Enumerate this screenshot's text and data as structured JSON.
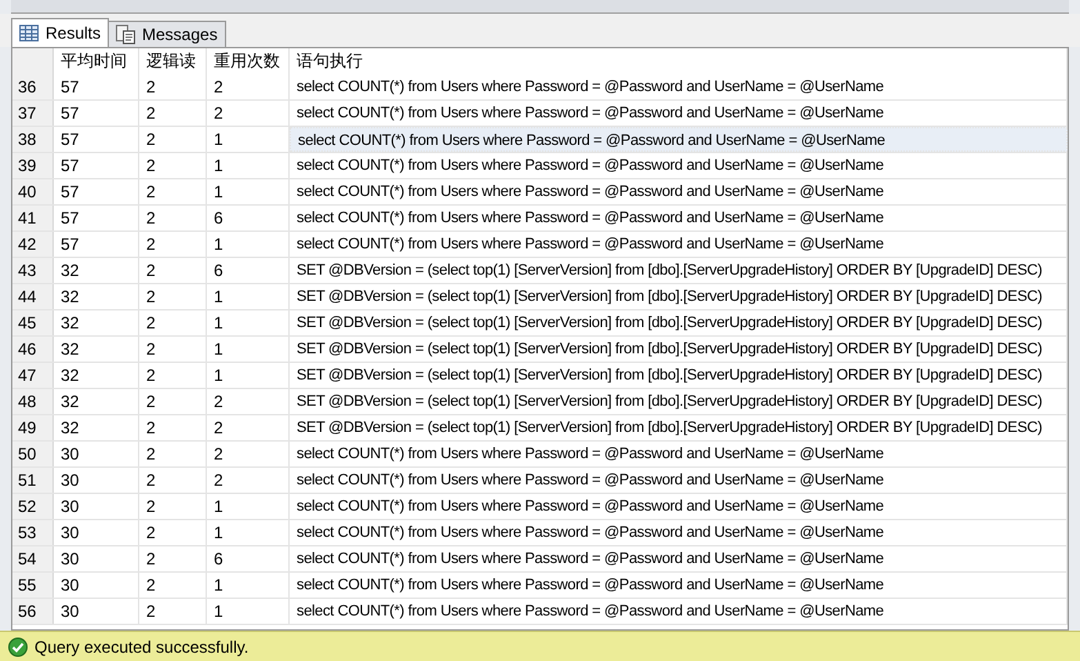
{
  "tabs": [
    {
      "label": "Results",
      "selected": true
    },
    {
      "label": "Messages",
      "selected": false
    }
  ],
  "table": {
    "columns": [
      "平均时间",
      "逻辑读",
      "重用次数",
      "语句执行"
    ],
    "rows": [
      {
        "row_number": "36",
        "cells": [
          "57",
          "2",
          "2",
          "select COUNT(*) from Users where Password = @Password and UserName = @UserName"
        ],
        "selected": false
      },
      {
        "row_number": "37",
        "cells": [
          "57",
          "2",
          "2",
          "select COUNT(*) from Users where Password = @Password and UserName = @UserName"
        ],
        "selected": false
      },
      {
        "row_number": "38",
        "cells": [
          "57",
          "2",
          "1",
          "select COUNT(*) from Users where Password = @Password and UserName = @UserName"
        ],
        "selected": true
      },
      {
        "row_number": "39",
        "cells": [
          "57",
          "2",
          "1",
          "select COUNT(*) from Users where Password = @Password and UserName = @UserName"
        ],
        "selected": false
      },
      {
        "row_number": "40",
        "cells": [
          "57",
          "2",
          "1",
          "select COUNT(*) from Users where Password = @Password and UserName = @UserName"
        ],
        "selected": false
      },
      {
        "row_number": "41",
        "cells": [
          "57",
          "2",
          "6",
          "select COUNT(*) from Users where Password = @Password and UserName = @UserName"
        ],
        "selected": false
      },
      {
        "row_number": "42",
        "cells": [
          "57",
          "2",
          "1",
          "select COUNT(*) from Users where Password = @Password and UserName = @UserName"
        ],
        "selected": false
      },
      {
        "row_number": "43",
        "cells": [
          "32",
          "2",
          "6",
          "SET @DBVersion = (select top(1) [ServerVersion] from [dbo].[ServerUpgradeHistory] ORDER BY [UpgradeID] DESC)"
        ],
        "selected": false
      },
      {
        "row_number": "44",
        "cells": [
          "32",
          "2",
          "1",
          "SET @DBVersion = (select top(1) [ServerVersion] from [dbo].[ServerUpgradeHistory] ORDER BY [UpgradeID] DESC)"
        ],
        "selected": false
      },
      {
        "row_number": "45",
        "cells": [
          "32",
          "2",
          "1",
          "SET @DBVersion = (select top(1) [ServerVersion] from [dbo].[ServerUpgradeHistory] ORDER BY [UpgradeID] DESC)"
        ],
        "selected": false
      },
      {
        "row_number": "46",
        "cells": [
          "32",
          "2",
          "1",
          "SET @DBVersion = (select top(1) [ServerVersion] from [dbo].[ServerUpgradeHistory] ORDER BY [UpgradeID] DESC)"
        ],
        "selected": false
      },
      {
        "row_number": "47",
        "cells": [
          "32",
          "2",
          "1",
          "SET @DBVersion = (select top(1) [ServerVersion] from [dbo].[ServerUpgradeHistory] ORDER BY [UpgradeID] DESC)"
        ],
        "selected": false
      },
      {
        "row_number": "48",
        "cells": [
          "32",
          "2",
          "2",
          "SET @DBVersion = (select top(1) [ServerVersion] from [dbo].[ServerUpgradeHistory] ORDER BY [UpgradeID] DESC)"
        ],
        "selected": false
      },
      {
        "row_number": "49",
        "cells": [
          "32",
          "2",
          "2",
          "SET @DBVersion = (select top(1) [ServerVersion] from [dbo].[ServerUpgradeHistory] ORDER BY [UpgradeID] DESC)"
        ],
        "selected": false
      },
      {
        "row_number": "50",
        "cells": [
          "30",
          "2",
          "2",
          "select COUNT(*) from Users where Password = @Password and UserName = @UserName"
        ],
        "selected": false
      },
      {
        "row_number": "51",
        "cells": [
          "30",
          "2",
          "2",
          "select COUNT(*) from Users where Password = @Password and UserName = @UserName"
        ],
        "selected": false
      },
      {
        "row_number": "52",
        "cells": [
          "30",
          "2",
          "1",
          "select COUNT(*) from Users where Password = @Password and UserName = @UserName"
        ],
        "selected": false
      },
      {
        "row_number": "53",
        "cells": [
          "30",
          "2",
          "1",
          "select COUNT(*) from Users where Password = @Password and UserName = @UserName"
        ],
        "selected": false
      },
      {
        "row_number": "54",
        "cells": [
          "30",
          "2",
          "6",
          "select COUNT(*) from Users where Password = @Password and UserName = @UserName"
        ],
        "selected": false
      },
      {
        "row_number": "55",
        "cells": [
          "30",
          "2",
          "1",
          "select COUNT(*) from Users where Password = @Password and UserName = @UserName"
        ],
        "selected": false
      },
      {
        "row_number": "56",
        "cells": [
          "30",
          "2",
          "1",
          "select COUNT(*) from Users where Password = @Password and UserName = @UserName"
        ],
        "selected": false
      }
    ]
  },
  "status_bar": {
    "text": "Query executed successfully."
  }
}
